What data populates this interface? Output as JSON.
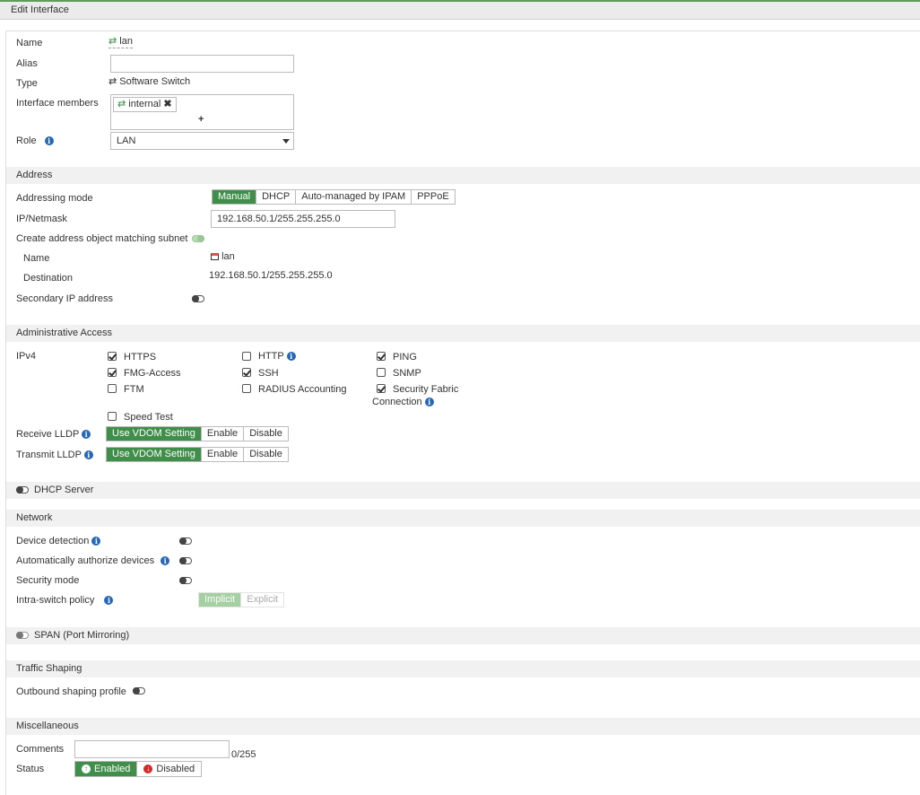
{
  "title": "Edit Interface",
  "general": {
    "name_label": "Name",
    "name_value": "lan",
    "alias_label": "Alias",
    "alias_value": "",
    "type_label": "Type",
    "type_value": "Software Switch",
    "members_label": "Interface members",
    "member_chip": "internal",
    "add_symbol": "+",
    "role_label": "Role",
    "role_value": "LAN"
  },
  "address": {
    "header": "Address",
    "mode_label": "Addressing mode",
    "modes": [
      "Manual",
      "DHCP",
      "Auto-managed by IPAM",
      "PPPoE"
    ],
    "ip_label": "IP/Netmask",
    "ip_value": "192.168.50.1/255.255.255.0",
    "create_obj_label": "Create address object matching subnet",
    "obj_name_label": "Name",
    "obj_name_value": "lan",
    "dest_label": "Destination",
    "dest_value": "192.168.50.1/255.255.255.0",
    "secondary_label": "Secondary IP address"
  },
  "admin": {
    "header": "Administrative Access",
    "ipv4_label": "IPv4",
    "https": "HTTPS",
    "http": "HTTP",
    "ping": "PING",
    "fmg": "FMG-Access",
    "ssh": "SSH",
    "snmp": "SNMP",
    "ftm": "FTM",
    "radius": "RADIUS Accounting",
    "fabric_line1": "Security Fabric",
    "fabric_line2": "Connection",
    "speed": "Speed Test",
    "receive_lldp_label": "Receive LLDP",
    "transmit_lldp_label": "Transmit LLDP",
    "lldp_options": [
      "Use VDOM Setting",
      "Enable",
      "Disable"
    ]
  },
  "dhcp": {
    "header": "DHCP Server"
  },
  "network": {
    "header": "Network",
    "device_detection": "Device detection",
    "auto_authorize": "Automatically authorize devices",
    "security_mode": "Security mode",
    "intra_switch": "Intra-switch policy",
    "intra_options": [
      "Implicit",
      "Explicit"
    ]
  },
  "span": {
    "header": "SPAN (Port Mirroring)"
  },
  "traffic": {
    "header": "Traffic Shaping",
    "outbound_label": "Outbound shaping profile"
  },
  "misc": {
    "header": "Miscellaneous",
    "comments_label": "Comments",
    "comments_count": "0/255",
    "status_label": "Status",
    "enabled": "Enabled",
    "disabled": "Disabled"
  }
}
